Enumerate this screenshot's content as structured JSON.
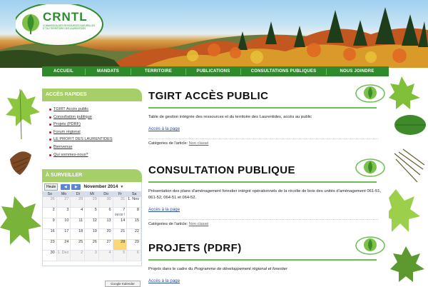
{
  "brand": {
    "logo_text": "CRNTL",
    "logo_subtitle_1": "COMMISSION DES RESSOURCES NATURELLES",
    "logo_subtitle_2": "ET DU TERRITOIRE DES LAURENTIDES"
  },
  "nav": {
    "items": [
      "ACCUEIL",
      "MANDATS",
      "TERRITOIRE",
      "PUBLICATIONS",
      "CONSULTATIONS PUBLIQUES",
      "NOUS JOINDRE"
    ]
  },
  "sidebar": {
    "quick_title": "ACCÈS RAPIDES",
    "quick_links": [
      "TGIRT Accès public",
      "Consultation publique",
      "Projets (PDRF)",
      "Forum régional",
      "LE PROFIT DES LAURENTIDES",
      "Bienvenue",
      "Qui sommes-nous?"
    ],
    "watch_title": "À SURVEILLER"
  },
  "calendar": {
    "today_label": "Heute",
    "prev_label": "◀",
    "next_label": "▶",
    "month_label": "November 2014",
    "dropdown": "▼",
    "dow": [
      "So",
      "Mo",
      "Di",
      "Mi",
      "Do",
      "Fr",
      "Sa"
    ],
    "weeks": [
      [
        "26",
        "27",
        "28",
        "29",
        "30",
        "31",
        "1. Nov"
      ],
      [
        "2",
        "3",
        "4",
        "5",
        "6",
        "7",
        "8"
      ],
      [
        "9",
        "10",
        "11",
        "12",
        "13",
        "14",
        "15"
      ],
      [
        "16",
        "17",
        "18",
        "19",
        "20",
        "21",
        "22"
      ],
      [
        "23",
        "24",
        "25",
        "26",
        "27",
        "28",
        "29"
      ],
      [
        "30",
        "1. Dez",
        "2",
        "3",
        "4",
        "5",
        "6"
      ]
    ],
    "event_text": "09:00 f",
    "google_badge": "Google Kalender"
  },
  "posts": [
    {
      "title": "TGIRT ACCÈS PUBLIC",
      "body_plain": "Table de gestion intégrée des ressources et du territoire des Laurentides, accès au public",
      "body_em": "",
      "link": "Accès à la page",
      "cat_label": "Catégories de l'article:",
      "cat_value": "Non classé"
    },
    {
      "title": "CONSULTATION PUBLIQUE",
      "body_plain": "Présentation des plans d'aménagement forestier intégré opérationnels de la récolte de bois des unités d'aménagement 061-51, 061-52, 064-51 et 064-52.",
      "body_em": "",
      "link": "Accès à la page",
      "cat_label": "Catégories de l'article:",
      "cat_value": "Non classé"
    },
    {
      "title": "PROJETS (PDRF)",
      "body_plain": "Projets dans le cadre du ",
      "body_em": "Programme de développement régional et forestier",
      "link": "Accès à la page",
      "cat_label": "",
      "cat_value": ""
    }
  ],
  "colors": {
    "nav_green": "#2f8a2c",
    "accent_green": "#6bbf52",
    "sidebar_head": "#a6cf6a",
    "link_blue": "#2a4ea6",
    "today_yellow": "#fbd77a"
  }
}
